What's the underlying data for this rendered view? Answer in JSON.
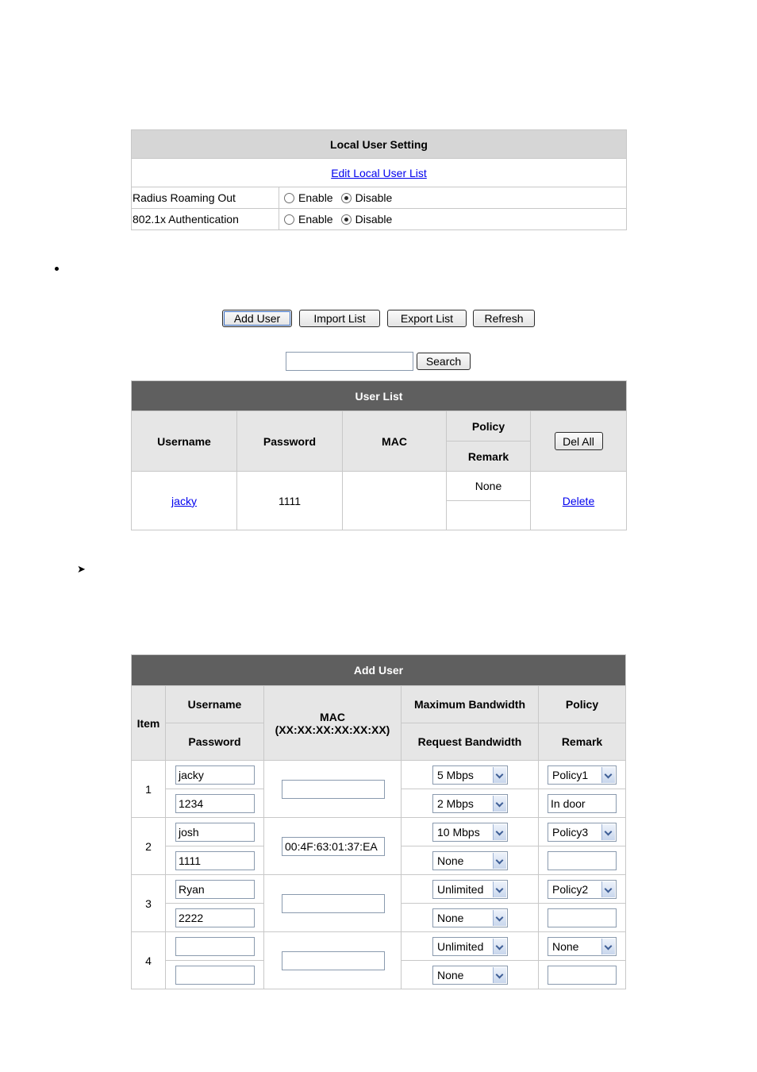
{
  "local_user_setting": {
    "title": "Local User Setting",
    "edit_link": "Edit Local User List",
    "rows": [
      {
        "label": "Radius Roaming Out",
        "opt1": "Enable",
        "opt2": "Disable",
        "selected": "Disable"
      },
      {
        "label": "802.1x Authentication",
        "opt1": "Enable",
        "opt2": "Disable",
        "selected": "Disable"
      }
    ]
  },
  "toolbar": {
    "add_user": "Add User",
    "import_list": "Import List",
    "export_list": "Export List",
    "refresh": "Refresh"
  },
  "search": {
    "value": "",
    "button": "Search"
  },
  "user_list": {
    "title": "User List",
    "headers": {
      "username": "Username",
      "password": "Password",
      "mac": "MAC",
      "policy": "Policy",
      "remark": "Remark",
      "del_all": "Del All"
    },
    "rows": [
      {
        "username": "jacky",
        "password": "1111",
        "mac": "",
        "policy": "None",
        "remark": "",
        "action": "Delete"
      }
    ]
  },
  "add_user": {
    "title": "Add User",
    "headers": {
      "item": "Item",
      "username": "Username",
      "password": "Password",
      "mac": "MAC",
      "mac_format": "(XX:XX:XX:XX:XX:XX)",
      "max_bw": "Maximum Bandwidth",
      "req_bw": "Request Bandwidth",
      "policy": "Policy",
      "remark": "Remark"
    },
    "rows": [
      {
        "item": "1",
        "username": "jacky",
        "password": "1234",
        "mac": "",
        "max_bw": "5 Mbps",
        "req_bw": "2 Mbps",
        "policy": "Policy1",
        "remark": "In door"
      },
      {
        "item": "2",
        "username": "josh",
        "password": "1111",
        "mac": "00:4F:63:01:37:EA",
        "max_bw": "10 Mbps",
        "req_bw": "None",
        "policy": "Policy3",
        "remark": ""
      },
      {
        "item": "3",
        "username": "Ryan",
        "password": "2222",
        "mac": "",
        "max_bw": "Unlimited",
        "req_bw": "None",
        "policy": "Policy2",
        "remark": ""
      },
      {
        "item": "4",
        "username": "",
        "password": "",
        "mac": "",
        "max_bw": "Unlimited",
        "req_bw": "None",
        "policy": "None",
        "remark": ""
      }
    ]
  }
}
